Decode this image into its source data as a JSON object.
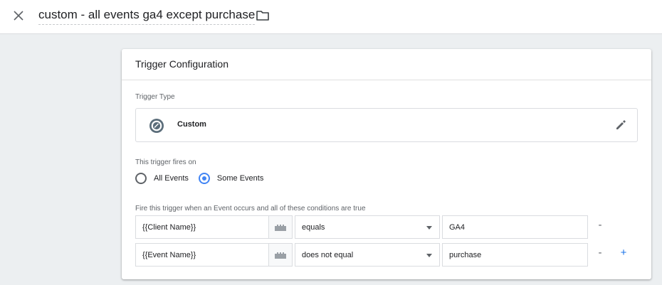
{
  "header": {
    "title": "custom - all events ga4 except purchase",
    "close_icon": "close-icon",
    "folder_icon": "folder-icon"
  },
  "card": {
    "title": "Trigger Configuration",
    "trigger_type_label": "Trigger Type",
    "trigger_type": {
      "name": "Custom",
      "icon": "custom-trigger-icon",
      "edit_icon": "pencil-icon"
    },
    "fires_on_label": "This trigger fires on",
    "fires_on_options": [
      {
        "label": "All Events",
        "selected": false
      },
      {
        "label": "Some Events",
        "selected": true
      }
    ],
    "conditions_label": "Fire this trigger when an Event occurs and all of these conditions are true",
    "conditions": [
      {
        "variable": "{{Client Name}}",
        "operator": "equals",
        "value": "GA4",
        "remove": "-"
      },
      {
        "variable": "{{Event Name}}",
        "operator": "does not equal",
        "value": "purchase",
        "remove": "-",
        "add": "+"
      }
    ]
  },
  "colors": {
    "accent": "#4285f4",
    "link_blue": "#1a73e8",
    "background": "#eceff1"
  }
}
